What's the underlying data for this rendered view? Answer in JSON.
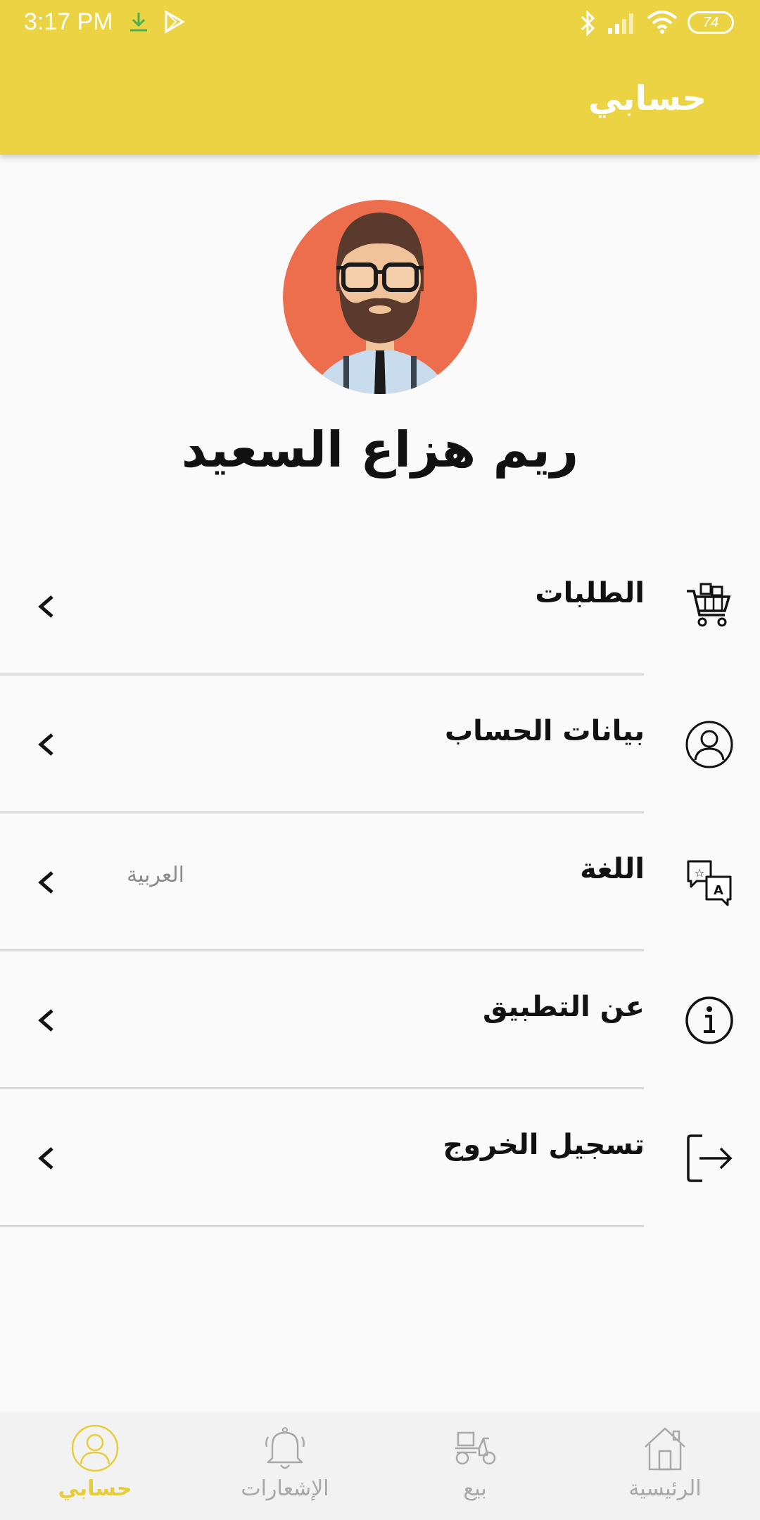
{
  "status_bar": {
    "time": "3:17 PM",
    "battery": "74"
  },
  "header": {
    "title": "حسابي"
  },
  "profile": {
    "name": "ريم هزاع السعيد"
  },
  "menu": [
    {
      "label": "الطلبات",
      "icon": "shopping-cart-icon"
    },
    {
      "label": "بيانات الحساب",
      "icon": "user-circle-icon"
    },
    {
      "label": "اللغة",
      "value": "العربية",
      "icon": "translate-icon"
    },
    {
      "label": "عن التطبيق",
      "icon": "info-icon"
    },
    {
      "label": "تسجيل الخروج",
      "icon": "logout-icon"
    }
  ],
  "bottom_nav": {
    "account": "حسابي",
    "notifications": "الإشعارات",
    "sell": "بيع",
    "home": "الرئيسية"
  },
  "colors": {
    "accent": "#ebd344",
    "active_nav": "#e8cd3a",
    "avatar_bg": "#ec6e4c"
  }
}
